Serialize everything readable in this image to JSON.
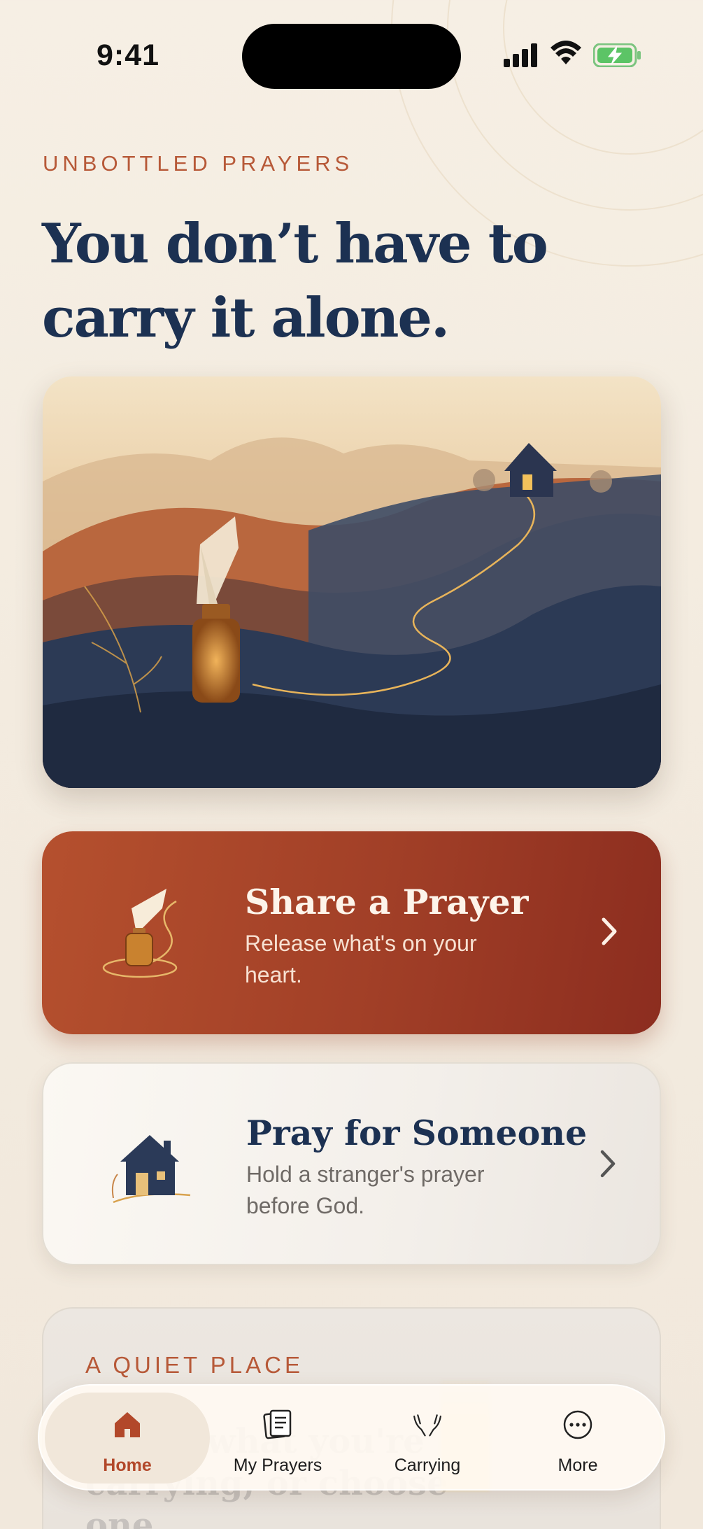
{
  "status_bar": {
    "time": "9:41"
  },
  "header": {
    "eyebrow": "UNBOTTLED PRAYERS",
    "title": "You don’t have to carry it alone."
  },
  "actions": [
    {
      "title": "Share a Prayer",
      "subtitle": "Release what's on your heart.",
      "icon": "bottle-icon"
    },
    {
      "title": "Pray for Someone",
      "subtitle": "Hold a stranger's prayer before God.",
      "icon": "house-icon"
    }
  ],
  "quiet_place": {
    "eyebrow": "A QUIET PLACE",
    "text": "Share what you're carrying, or choose one"
  },
  "tab_bar": {
    "active": "Home",
    "tabs": [
      {
        "label": "Home",
        "icon": "home-icon"
      },
      {
        "label": "My Prayers",
        "icon": "notes-icon"
      },
      {
        "label": "Carrying",
        "icon": "praying-hands-icon"
      },
      {
        "label": "More",
        "icon": "more-icon"
      }
    ]
  },
  "colors": {
    "accent": "#b75938",
    "navy": "#1c3152",
    "share_card": "#a13f27",
    "background": "#f4ede2"
  }
}
